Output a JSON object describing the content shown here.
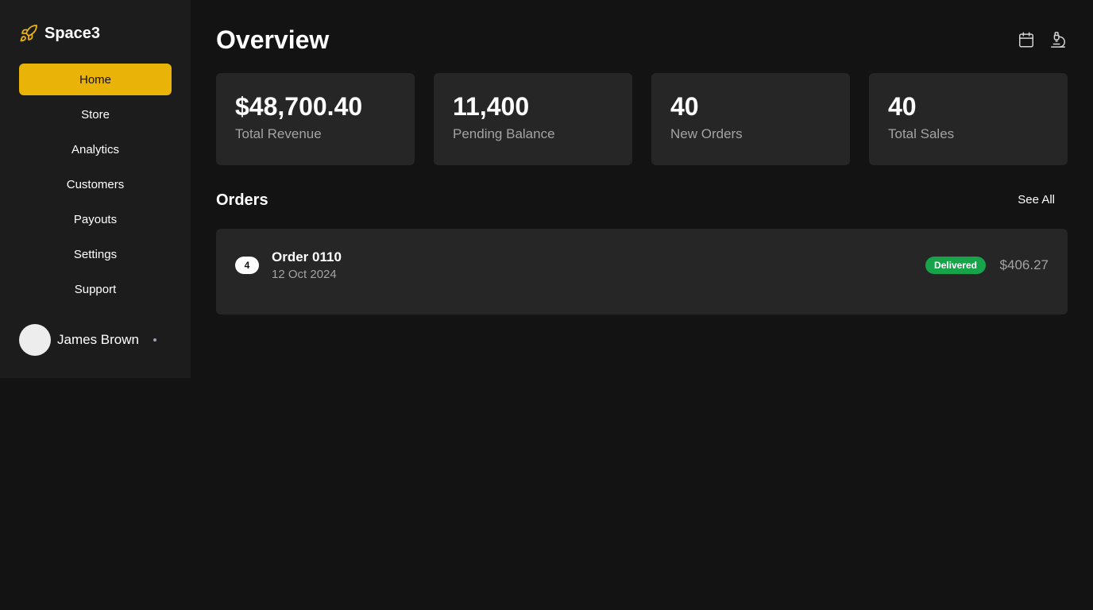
{
  "app": {
    "name": "Space3",
    "logo_icon": "rocket-icon",
    "accent_color": "#eab308"
  },
  "sidebar": {
    "items": [
      {
        "label": "Home",
        "active": true
      },
      {
        "label": "Store",
        "active": false
      },
      {
        "label": "Analytics",
        "active": false
      },
      {
        "label": "Customers",
        "active": false
      },
      {
        "label": "Payouts",
        "active": false
      },
      {
        "label": "Settings",
        "active": false
      },
      {
        "label": "Support",
        "active": false
      }
    ],
    "user": {
      "name": "James Brown"
    }
  },
  "header": {
    "title": "Overview",
    "icons": [
      "calendar-icon",
      "microscope-icon"
    ]
  },
  "stats": [
    {
      "value": "$48,700.40",
      "label": "Total Revenue"
    },
    {
      "value": "11,400",
      "label": "Pending Balance"
    },
    {
      "value": "40",
      "label": "New Orders"
    },
    {
      "value": "40",
      "label": "Total Sales"
    }
  ],
  "orders": {
    "title": "Orders",
    "see_all_label": "See All",
    "items": [
      {
        "quantity": "4",
        "name": "Order 0110",
        "date": "12 Oct 2024",
        "status": "Delivered",
        "status_color": "#16a34a",
        "amount": "$406.27"
      }
    ]
  }
}
